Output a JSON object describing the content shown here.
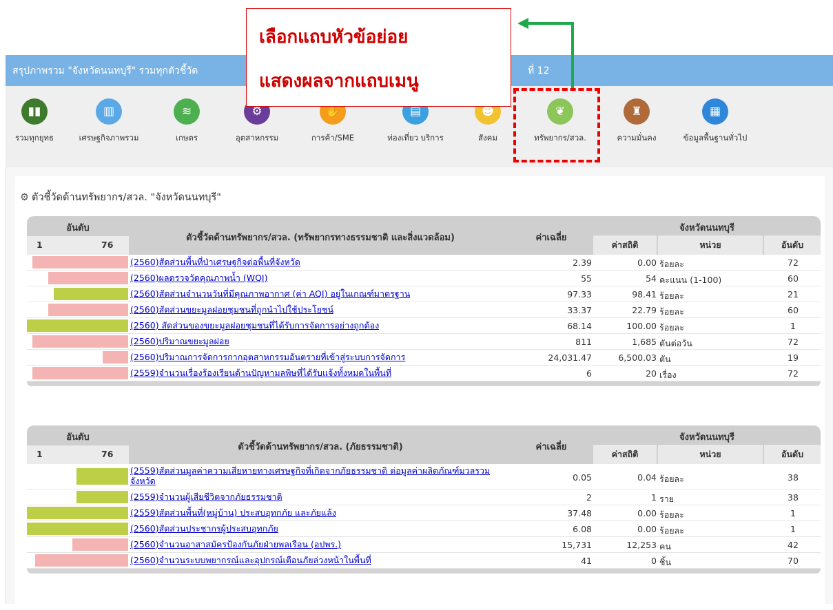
{
  "header": {
    "title_left": "สรุปภาพรวม \"จังหวัดนนทบุรี\" รวมทุกตัวชี้วัด",
    "title_right": "ที่ 12"
  },
  "annotation": {
    "line1": "เลือกแถบหัวข้อย่อย",
    "line2": "แสดงผลจากแถบเมนู"
  },
  "nav": [
    {
      "label": "รวมทุกยุทธ",
      "icon": "bar-chart-icon",
      "color": "#3d7a2b"
    },
    {
      "label": "เศรษฐกิจภาพรวม",
      "icon": "economy-chart-icon",
      "color": "#5aa9e6"
    },
    {
      "label": "เกษตร",
      "icon": "farm-field-icon",
      "color": "#4caf50"
    },
    {
      "label": "อุตสาหกรรม",
      "icon": "factory-icon",
      "color": "#6a3d9a"
    },
    {
      "label": "การค้า/SME",
      "icon": "handshake-icon",
      "color": "#f59c1a"
    },
    {
      "label": "ท่องเที่ยว บริการ",
      "icon": "luggage-icon",
      "color": "#3aa0e0"
    },
    {
      "label": "สังคม",
      "icon": "people-icon",
      "color": "#f2c230"
    },
    {
      "label": "ทรัพยากร/สวล.",
      "icon": "plant-icon",
      "color": "#8cc55a"
    },
    {
      "label": "ความมั่นคง",
      "icon": "security-icon",
      "color": "#b06a3a"
    },
    {
      "label": "ข้อมูลพื้นฐานทั่วไป",
      "icon": "document-icon",
      "color": "#2e87d9"
    }
  ],
  "section_title": "ตัวชี้วัดด้านทรัพยากร/สวล. \"จังหวัดนนทบุรี\"",
  "tables": [
    {
      "rank_header": "อันดับ",
      "rank_min": "1",
      "rank_max": "76",
      "indicator_header": "ตัวชี้วัดด้านทรัพยากร/สวล. (ทรัพยากรทางธรรมชาติ และสิ่งแวดล้อม)",
      "avg_header": "ค่าเฉลี่ย",
      "province_header": "จังหวัดนนทบุรี",
      "stat_header": "ค่าสถิติ",
      "unit_header": "หน่วย",
      "rank_col_header": "อันดับ",
      "rows": [
        {
          "indicator": "(2560)สัดส่วนพื้นที่ป่าเศรษฐกิจต่อพื้นที่จังหวัด",
          "avg": "2.39",
          "stat": "0.00",
          "unit": "ร้อยละ",
          "rank": "72",
          "bar_color": "#f4b4b4",
          "tall": false
        },
        {
          "indicator": "(2560)ผลตรวจวัดคุณภาพน้ำ (WQI)",
          "avg": "55",
          "stat": "54",
          "unit": "คะแนน (1-100)",
          "rank": "60",
          "bar_color": "#f4b4b4",
          "tall": false
        },
        {
          "indicator": "(2560)สัดส่วนจำนวนวันที่มีคุณภาพอากาศ (ค่า AQI) อยู่ในเกณฑ์มาตรฐาน",
          "avg": "97.33",
          "stat": "98.41",
          "unit": "ร้อยละ",
          "rank": "21",
          "bar_color": "#bccf46",
          "tall": false
        },
        {
          "indicator": "(2560)สัดส่วนขยะมูลฝอยชุมชนที่ถูกนำไปใช้ประโยชน์",
          "avg": "33.37",
          "stat": "22.79",
          "unit": "ร้อยละ",
          "rank": "60",
          "bar_color": "#f4b4b4",
          "tall": false
        },
        {
          "indicator": "(2560) สัดส่วนของขยะมูลฝอยชุมชนที่ได้รับการจัดการอย่างถูกต้อง",
          "avg": "68.14",
          "stat": "100.00",
          "unit": "ร้อยละ",
          "rank": "1",
          "bar_color": "#bccf46",
          "tall": false
        },
        {
          "indicator": "(2560)ปริมาณขยะมูลฝอย",
          "avg": "811",
          "stat": "1,685",
          "unit": "ตันต่อวัน",
          "rank": "72",
          "bar_color": "#f4b4b4",
          "tall": false
        },
        {
          "indicator": "(2560)ปริมาณการจัดการกากอุตสาหกรรมอันตรายที่เข้าสู่ระบบการจัดการ",
          "avg": "24,031.47",
          "stat": "6,500.03",
          "unit": "ตัน",
          "rank": "19",
          "bar_color": "#f4b4b4",
          "tall": false
        },
        {
          "indicator": "(2559)จำนวนเรื่องร้องเรียนด้านปัญหามลพิษที่ได้รับแจ้งทั้งหมดในพื้นที่",
          "avg": "6",
          "stat": "20",
          "unit": "เรื่อง",
          "rank": "72",
          "bar_color": "#f4b4b4",
          "tall": false
        }
      ]
    },
    {
      "rank_header": "อันดับ",
      "rank_min": "1",
      "rank_max": "76",
      "indicator_header": "ตัวชี้วัดด้านทรัพยากร/สวล. (ภัยธรรมชาติ)",
      "avg_header": "ค่าเฉลี่ย",
      "province_header": "จังหวัดนนทบุรี",
      "stat_header": "ค่าสถิติ",
      "unit_header": "หน่วย",
      "rank_col_header": "อันดับ",
      "rows": [
        {
          "indicator": "(2559)สัดส่วนมูลค่าความเสียหายทางเศรษฐกิจที่เกิดจากภัยธรรมชาติ ต่อมูลค่าผลิตภัณฑ์มวลรวมจังหวัด",
          "avg": "0.05",
          "stat": "0.04",
          "unit": "ร้อยละ",
          "rank": "38",
          "bar_color": "#bccf46",
          "tall": true
        },
        {
          "indicator": "(2559)จำนวนผู้เสียชีวิตจากภัยธรรมชาติ",
          "avg": "2",
          "stat": "1",
          "unit": "ราย",
          "rank": "38",
          "bar_color": "#bccf46",
          "tall": false
        },
        {
          "indicator": "(2559)สัดส่วนพื้นที่(หมู่บ้าน) ประสบอุทกภัย และภัยแล้ง",
          "avg": "37.48",
          "stat": "0.00",
          "unit": "ร้อยละ",
          "rank": "1",
          "bar_color": "#bccf46",
          "tall": false
        },
        {
          "indicator": "(2560)สัดส่วนประชากรผู้ประสบอุทกภัย",
          "avg": "6.08",
          "stat": "0.00",
          "unit": "ร้อยละ",
          "rank": "1",
          "bar_color": "#bccf46",
          "tall": false
        },
        {
          "indicator": "(2560)จำนวนอาสาสมัครป้องกันภัยฝ่ายพลเรือน (อปพร.)",
          "avg": "15,731",
          "stat": "12,253",
          "unit": "คน",
          "rank": "42",
          "bar_color": "#f4b4b4",
          "tall": false
        },
        {
          "indicator": "(2560)จำนวนระบบพยากรณ์และอุปกรณ์เตือนภัยล่วงหน้าในพื้นที่",
          "avg": "41",
          "stat": "0",
          "unit": "ชิ้น",
          "rank": "70",
          "bar_color": "#f4b4b4",
          "tall": false
        }
      ]
    }
  ]
}
